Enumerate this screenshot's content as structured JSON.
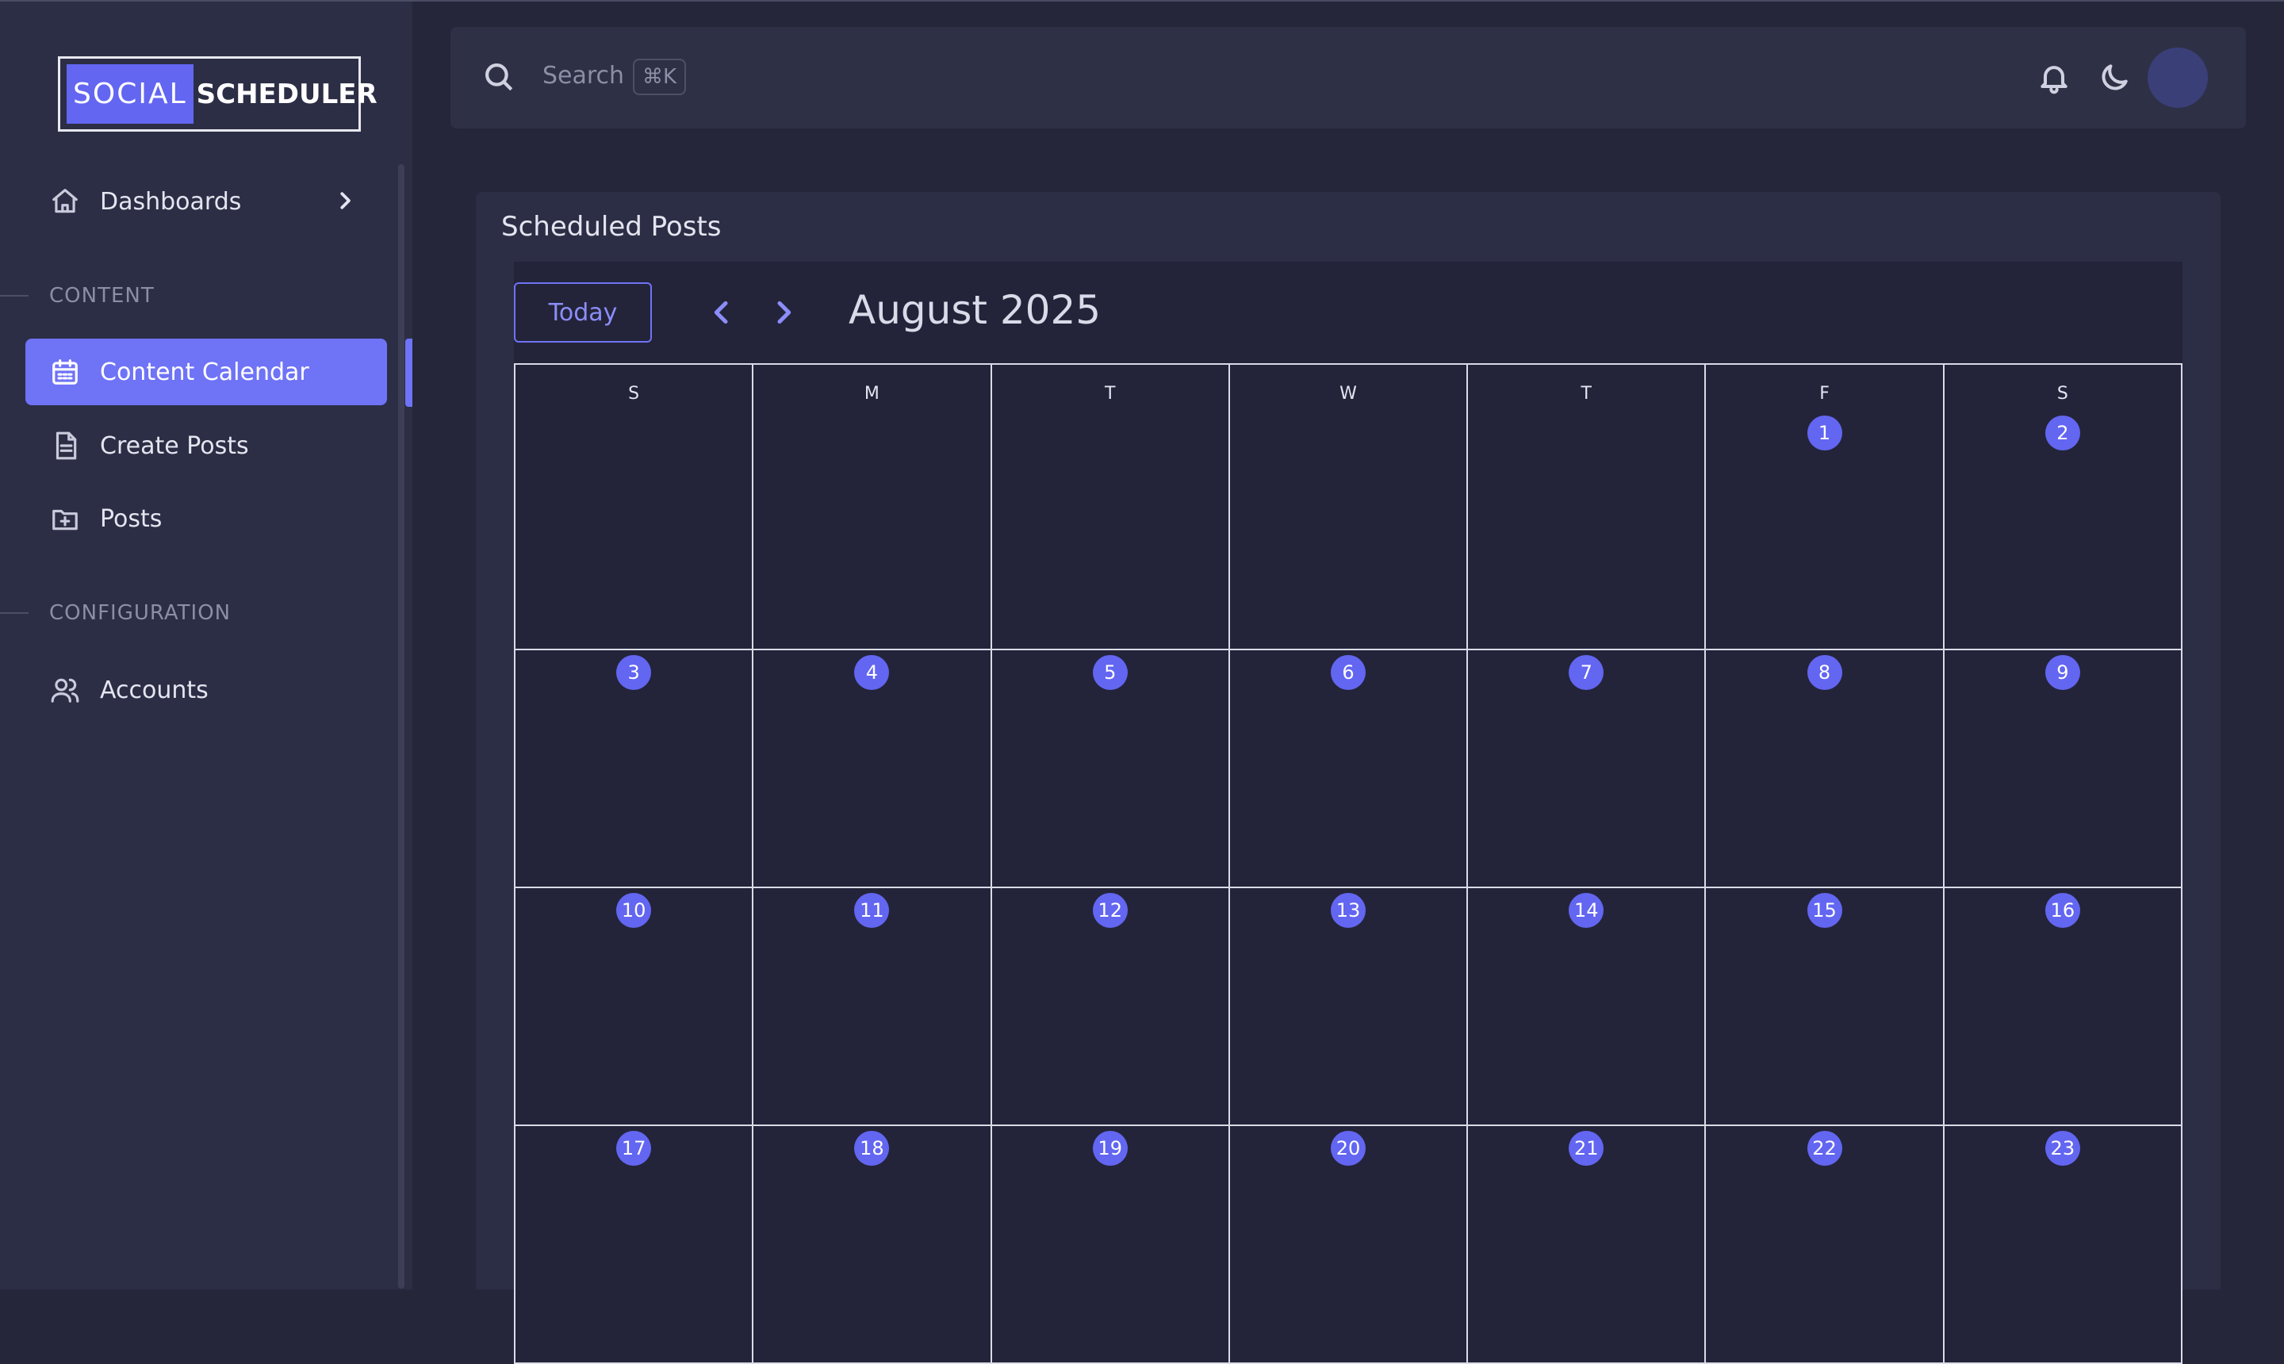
{
  "app": {
    "logo_part1": "SOCIAL",
    "logo_part2": "SCHEDULER"
  },
  "sidebar": {
    "dashboards_label": "Dashboards",
    "content_section": "CONTENT",
    "items": [
      {
        "label": "Content Calendar",
        "icon": "calendar-icon",
        "active": true
      },
      {
        "label": "Create Posts",
        "icon": "document-icon",
        "active": false
      },
      {
        "label": "Posts",
        "icon": "folder-plus-icon",
        "active": false
      }
    ],
    "config_section": "CONFIGURATION",
    "config_items": [
      {
        "label": "Accounts",
        "icon": "users-icon"
      }
    ]
  },
  "topbar": {
    "search_placeholder": "Search",
    "shortcut": "⌘K"
  },
  "main": {
    "card_title": "Scheduled Posts",
    "today_button": "Today",
    "month_title": "August 2025",
    "weekdays": [
      "S",
      "M",
      "T",
      "W",
      "T",
      "F",
      "S"
    ],
    "weeks": [
      [
        "",
        "",
        "",
        "",
        "",
        "1",
        "2"
      ],
      [
        "3",
        "4",
        "5",
        "6",
        "7",
        "8",
        "9"
      ],
      [
        "10",
        "11",
        "12",
        "13",
        "14",
        "15",
        "16"
      ],
      [
        "17",
        "18",
        "19",
        "20",
        "21",
        "22",
        "23"
      ]
    ]
  },
  "colors": {
    "accent": "#6366f1",
    "background": "#25263a",
    "sidebar": "#2c2e45"
  }
}
